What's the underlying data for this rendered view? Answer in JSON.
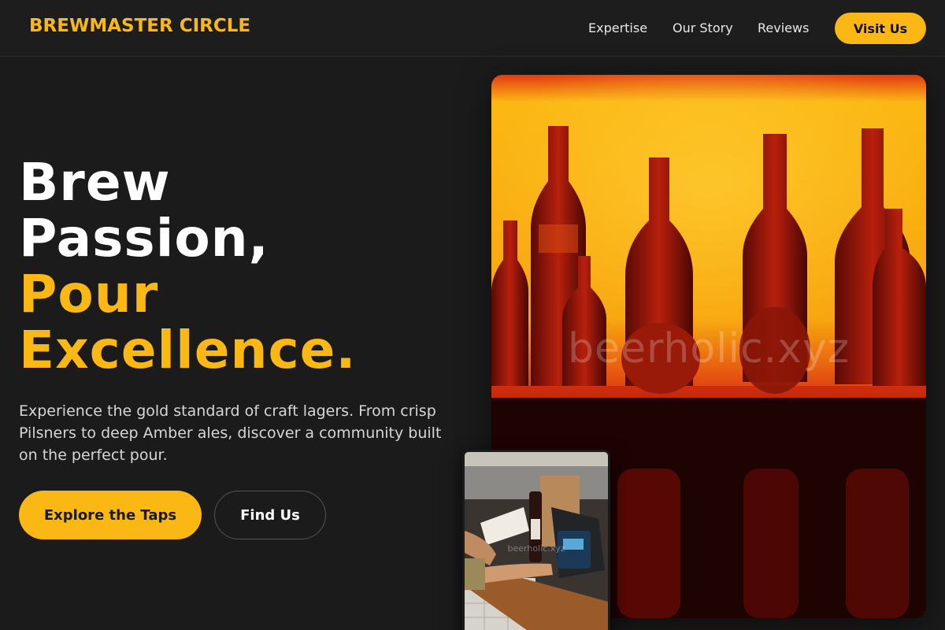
{
  "nav": {
    "brand": "BREWMASTER CIRCLE",
    "links": [
      "Expertise",
      "Our Story",
      "Reviews"
    ],
    "cta": "Visit Us"
  },
  "hero": {
    "title_lines": [
      "Brew",
      "Passion,",
      "Pour",
      "Excellence."
    ],
    "description": "Experience the gold standard of craft lagers. From crisp Pilsners to deep Amber ales, discover a community built on the perfect pour.",
    "primary_button": "Explore the Taps",
    "secondary_button": "Find Us"
  },
  "images": {
    "main_watermark": "beerholic.xyz",
    "inset_watermark": "beerholic.xyz"
  },
  "colors": {
    "background": "#1b1b1b",
    "accent": "#fbb814",
    "text": "#ffffff",
    "muted_text": "#d6d6d6"
  }
}
